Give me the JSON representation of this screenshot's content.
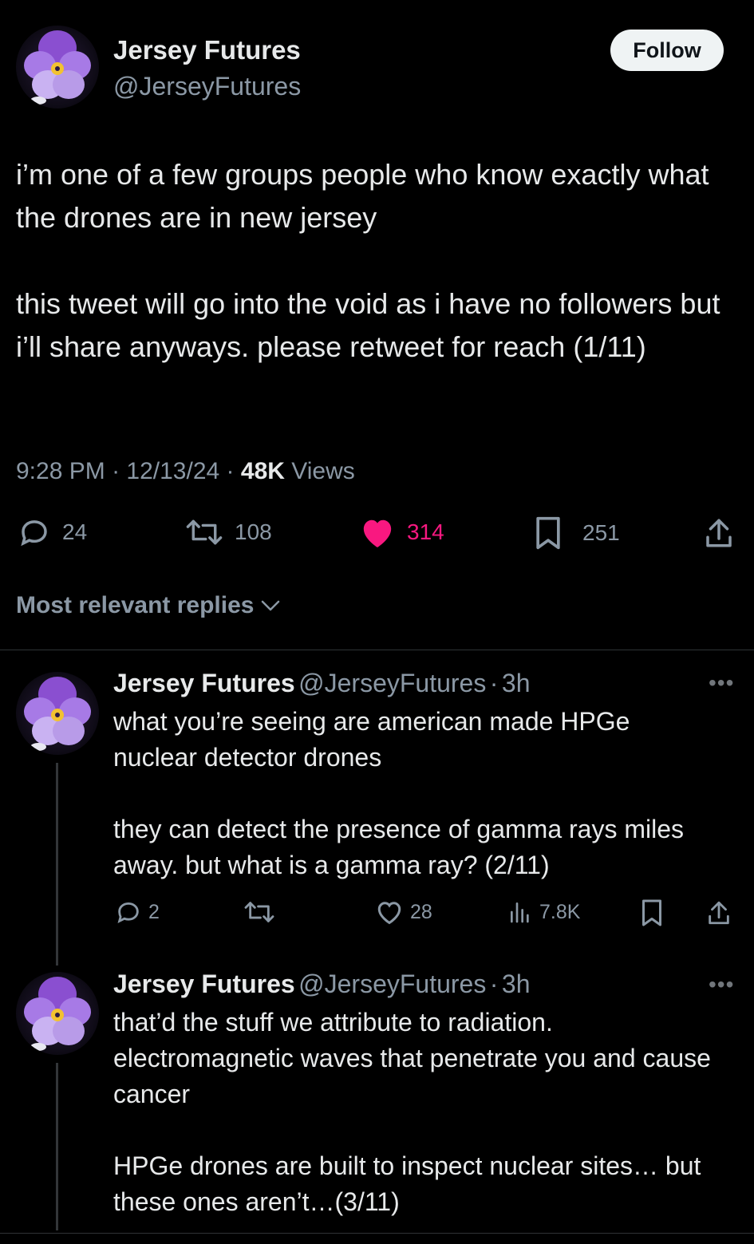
{
  "tweet": {
    "author_name": "Jersey Futures",
    "author_handle": "@JerseyFutures",
    "follow_label": "Follow",
    "text": "i’m one of a few groups people who know exactly what the drones are in new jersey\n\nthis tweet will go into the void as i have no followers but i’ll share anyways. please retweet for reach (1/11)",
    "time": "9:28 PM",
    "date": "12/13/24",
    "views_count": "48K",
    "views_label": "Views",
    "replies": "24",
    "retweets": "108",
    "likes": "314",
    "bookmarks": "251",
    "colors": {
      "like": "#f91880",
      "muted": "#8b98a5"
    }
  },
  "replies_header": {
    "label": "Most relevant replies"
  },
  "replies": [
    {
      "author_name": "Jersey Futures",
      "author_handle": "@JerseyFutures",
      "time_ago": "3h",
      "text": "what you’re seeing are american made HPGe nuclear detector drones\n\nthey can detect the presence of gamma rays miles away. but what is a gamma ray? (2/11)",
      "replies": "2",
      "likes": "28",
      "views": "7.8K"
    },
    {
      "author_name": "Jersey Futures",
      "author_handle": "@JerseyFutures",
      "time_ago": "3h",
      "text": "that’d the stuff we attribute to radiation. electromagnetic waves that penetrate you and cause cancer\n\nHPGe drones are built to inspect nuclear sites… but these ones aren’t…(3/11)"
    }
  ],
  "separator": "·",
  "icons": [
    "avatar-flower",
    "reply-icon",
    "retweet-icon",
    "heart-icon",
    "bookmark-icon",
    "share-icon",
    "views-icon",
    "more-icon",
    "chevron-down-icon"
  ]
}
